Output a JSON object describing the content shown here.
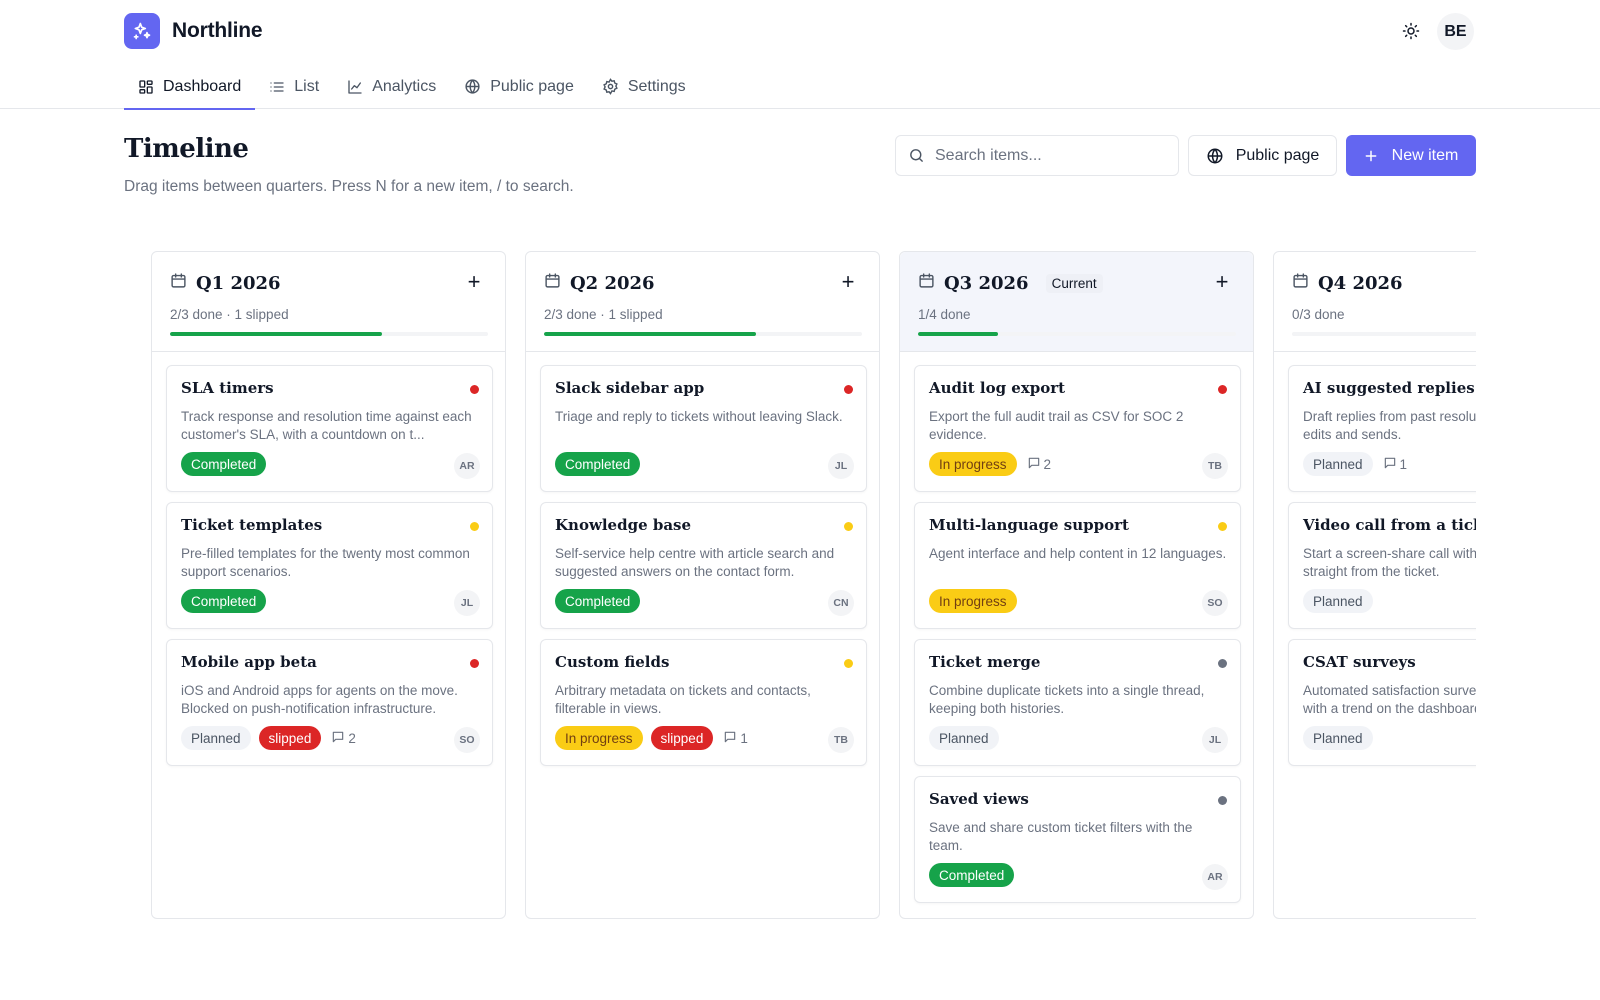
{
  "app": {
    "name": "Northline",
    "user_initials": "BE"
  },
  "nav": {
    "tabs": [
      {
        "label": "Dashboard",
        "icon": "dashboard-icon",
        "active": true
      },
      {
        "label": "List",
        "icon": "list-icon",
        "active": false
      },
      {
        "label": "Analytics",
        "icon": "analytics-icon",
        "active": false
      },
      {
        "label": "Public page",
        "icon": "globe-icon",
        "active": false
      },
      {
        "label": "Settings",
        "icon": "gear-icon",
        "active": false
      }
    ]
  },
  "page": {
    "title": "Timeline",
    "subtitle": "Drag items between quarters. Press N for a new item, / to search."
  },
  "toolbar": {
    "search_placeholder": "Search items...",
    "public_label": "Public page",
    "new_label": "New item"
  },
  "colors": {
    "accent": "#6366f1",
    "completed": "#16a34a",
    "in_progress": "#facc15",
    "slipped": "#dc2626",
    "priority_high": "#dc2626",
    "priority_medium": "#facc15",
    "priority_low": "#6b7280"
  },
  "columns": [
    {
      "title": "Q1 2026",
      "current": false,
      "current_label": "",
      "meta": "2/3 done · 1 slipped",
      "progress": 0.667,
      "cards": [
        {
          "title": "SLA timers",
          "desc": "Track response and resolution time against each customer's SLA, with a countdown on t...",
          "status": "Completed",
          "status_class": "completed",
          "slipped": "",
          "comments": "",
          "priority": "high",
          "assignee": "AR"
        },
        {
          "title": "Ticket templates",
          "desc": "Pre-filled templates for the twenty most common support scenarios.",
          "status": "Completed",
          "status_class": "completed",
          "slipped": "",
          "comments": "",
          "priority": "medium",
          "assignee": "JL"
        },
        {
          "title": "Mobile app beta",
          "desc": "iOS and Android apps for agents on the move. Blocked on push-notification infrastructure.",
          "status": "Planned",
          "status_class": "planned",
          "slipped": "slipped",
          "comments": "2",
          "priority": "high",
          "assignee": "SO"
        }
      ]
    },
    {
      "title": "Q2 2026",
      "current": false,
      "current_label": "",
      "meta": "2/3 done · 1 slipped",
      "progress": 0.667,
      "cards": [
        {
          "title": "Slack sidebar app",
          "desc": "Triage and reply to tickets without leaving Slack.",
          "status": "Completed",
          "status_class": "completed",
          "slipped": "",
          "comments": "",
          "priority": "high",
          "assignee": "JL"
        },
        {
          "title": "Knowledge base",
          "desc": "Self-service help centre with article search and suggested answers on the contact form.",
          "status": "Completed",
          "status_class": "completed",
          "slipped": "",
          "comments": "",
          "priority": "medium",
          "assignee": "CN"
        },
        {
          "title": "Custom fields",
          "desc": "Arbitrary metadata on tickets and contacts, filterable in views.",
          "status": "In progress",
          "status_class": "in-progress",
          "slipped": "slipped",
          "comments": "1",
          "priority": "medium",
          "assignee": "TB"
        }
      ]
    },
    {
      "title": "Q3 2026",
      "current": true,
      "current_label": "Current",
      "meta": "1/4 done",
      "progress": 0.25,
      "cards": [
        {
          "title": "Audit log export",
          "desc": "Export the full audit trail as CSV for SOC 2 evidence.",
          "status": "In progress",
          "status_class": "in-progress",
          "slipped": "",
          "comments": "2",
          "priority": "high",
          "assignee": "TB"
        },
        {
          "title": "Multi-language support",
          "desc": "Agent interface and help content in 12 languages.",
          "status": "In progress",
          "status_class": "in-progress",
          "slipped": "",
          "comments": "",
          "priority": "medium",
          "assignee": "SO"
        },
        {
          "title": "Ticket merge",
          "desc": "Combine duplicate tickets into a single thread, keeping both histories.",
          "status": "Planned",
          "status_class": "planned",
          "slipped": "",
          "comments": "",
          "priority": "low",
          "assignee": "JL"
        },
        {
          "title": "Saved views",
          "desc": "Save and share custom ticket filters with the team.",
          "status": "Completed",
          "status_class": "completed",
          "slipped": "",
          "comments": "",
          "priority": "low",
          "assignee": "AR"
        }
      ]
    },
    {
      "title": "Q4 2026",
      "current": false,
      "current_label": "",
      "meta": "0/3 done",
      "progress": 0,
      "cards": [
        {
          "title": "AI suggested replies",
          "desc": "Draft replies from past resolutions that the agent edits and sends.",
          "status": "Planned",
          "status_class": "planned",
          "slipped": "",
          "comments": "1",
          "priority": "",
          "assignee": ""
        },
        {
          "title": "Video call from a ticket",
          "desc": "Start a screen-share call with the customer straight from the ticket.",
          "status": "Planned",
          "status_class": "planned",
          "slipped": "",
          "comments": "",
          "priority": "",
          "assignee": ""
        },
        {
          "title": "CSAT surveys",
          "desc": "Automated satisfaction survey after resolution, with a trend on the dashboard.",
          "status": "Planned",
          "status_class": "planned",
          "slipped": "",
          "comments": "",
          "priority": "",
          "assignee": ""
        }
      ]
    }
  ]
}
